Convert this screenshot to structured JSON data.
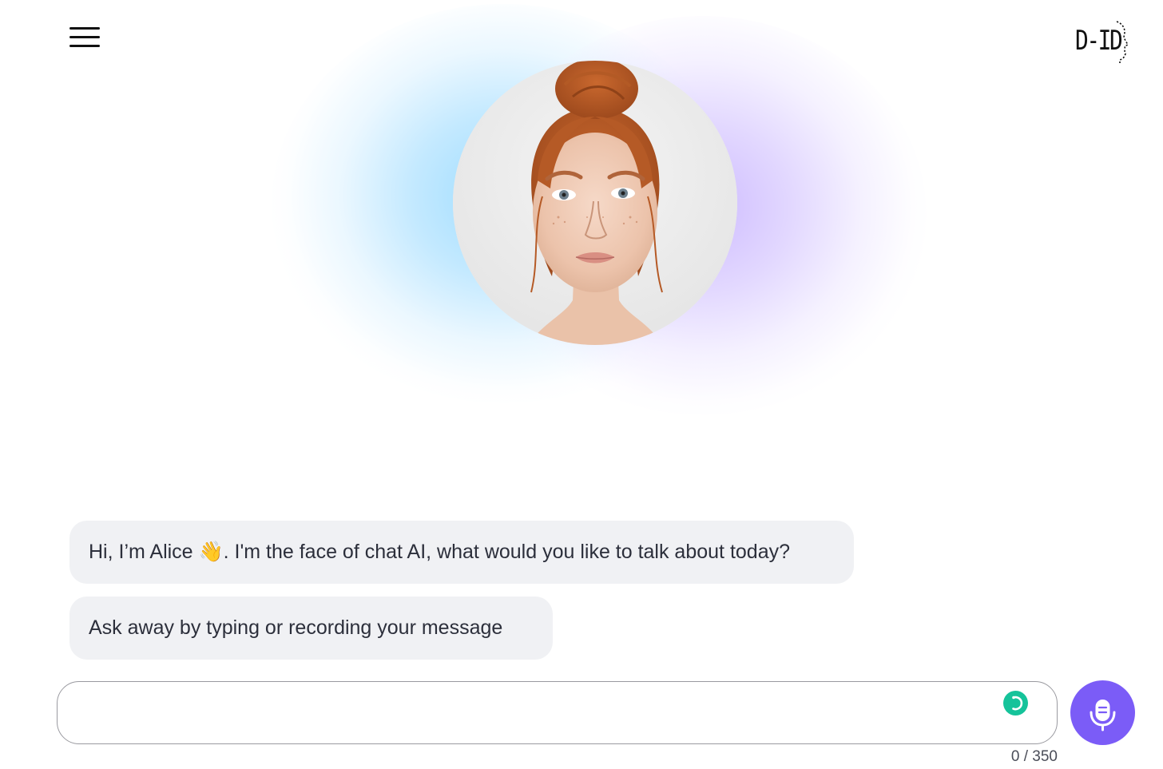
{
  "header": {
    "menu_icon": "hamburger-menu-icon",
    "logo_text": "D-ID"
  },
  "avatar": {
    "name": "Alice"
  },
  "chat": {
    "messages": [
      {
        "text": "Hi, I’m Alice 👋. I'm the face of chat AI, what would you like to talk about today?"
      },
      {
        "text": "Ask away by typing or recording your message"
      }
    ]
  },
  "input": {
    "value": "",
    "placeholder": "",
    "counter": "0 / 350"
  },
  "controls": {
    "mic_icon": "microphone-icon",
    "assistant_icon": "grammar-assistant-icon"
  },
  "colors": {
    "accent": "#7b5cf7",
    "assistant_badge": "#15c39a",
    "bubble_bg": "#f0f1f4",
    "glow_blue": "#98daff",
    "glow_purple": "#cbb8ff"
  }
}
